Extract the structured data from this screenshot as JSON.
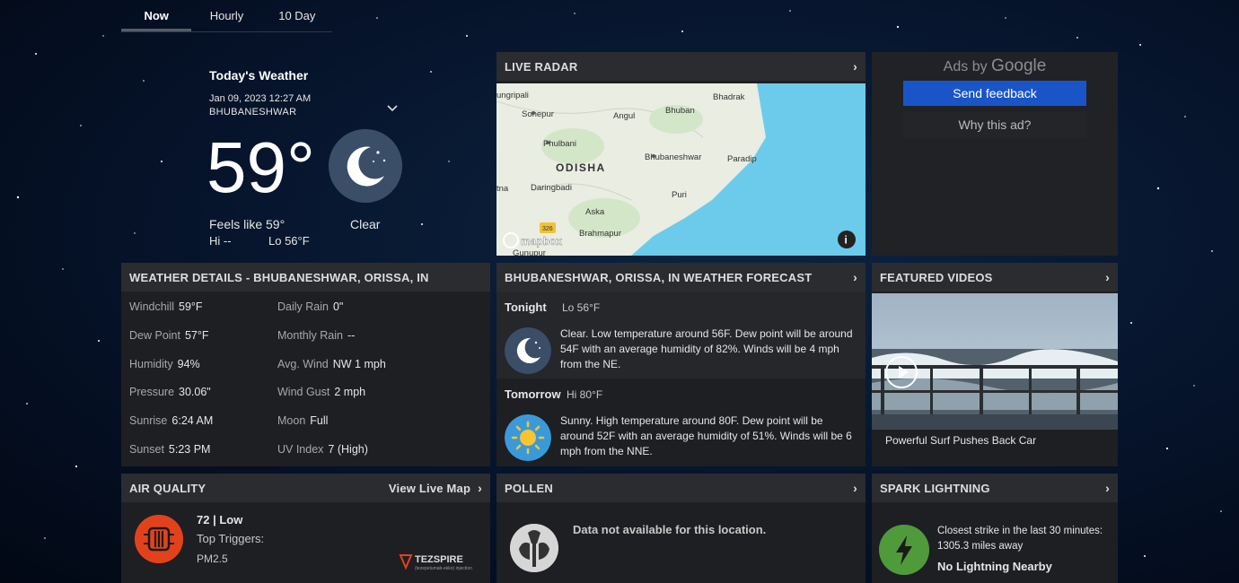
{
  "tabs": [
    {
      "label": "Now"
    },
    {
      "label": "Hourly"
    },
    {
      "label": "10 Day"
    }
  ],
  "today": {
    "title": "Today's Weather",
    "date": "Jan 09, 2023 12:27 AM",
    "city": "BHUBANESHWAR",
    "temp": "59°",
    "feels": "Feels like 59°",
    "condition": "Clear",
    "hi": "Hi --",
    "lo": "Lo 56°F",
    "icon": "moon-icon"
  },
  "radar": {
    "title": "LIVE RADAR",
    "state_label": "ODISHA",
    "places": [
      "ungripali",
      "Sonepur",
      "Angul",
      "Bhuban",
      "Bhadrak",
      "Phulbani",
      "Bhubaneshwar",
      "Paradip",
      "tna",
      "Daringbadi",
      "Puri",
      "Aska",
      "Brahmapur",
      "Gunupur"
    ],
    "road_badge": "326",
    "attribution": "mapbox"
  },
  "ads": {
    "ads_by": "Ads by",
    "google": "Google",
    "feedback": "Send feedback",
    "why": "Why this ad?"
  },
  "details": {
    "title": "WEATHER DETAILS - BHUBANESHWAR, ORISSA, IN",
    "rows": [
      {
        "l1": "Windchill",
        "v1": "59°F",
        "l2": "Daily Rain",
        "v2": "0\""
      },
      {
        "l1": "Dew Point",
        "v1": "57°F",
        "l2": "Monthly Rain",
        "v2": "--"
      },
      {
        "l1": "Humidity",
        "v1": "94%",
        "l2": "Avg. Wind",
        "v2": "NW 1 mph"
      },
      {
        "l1": "Pressure",
        "v1": "30.06\"",
        "l2": "Wind Gust",
        "v2": "2 mph"
      },
      {
        "l1": "Sunrise",
        "v1": "6:24 AM",
        "l2": "Moon",
        "v2": "Full"
      },
      {
        "l1": "Sunset",
        "v1": "5:23 PM",
        "l2": "UV Index",
        "v2": "7 (High)"
      }
    ]
  },
  "forecast": {
    "title": "BHUBANESHWAR, ORISSA, IN WEATHER FORECAST",
    "tonight_label": "Tonight",
    "tonight_temp": "Lo 56°F",
    "tonight_text": "Clear. Low temperature around 56F. Dew point will be around 54F with an average humidity of 82%. Winds will be 4 mph from the NE.",
    "tomorrow_label": "Tomorrow",
    "tomorrow_temp": "Hi 80°F",
    "tomorrow_text": "Sunny. High temperature around 80F. Dew point will be around 52F with an average humidity of 51%. Winds will be 6 mph from the NNE."
  },
  "videos": {
    "title": "FEATURED VIDEOS",
    "caption": "Powerful Surf Pushes Back Car"
  },
  "air_quality": {
    "title": "AIR QUALITY",
    "live_map": "View Live Map",
    "value": "72 | Low",
    "triggers": "Top Triggers:",
    "pm": "PM2.5",
    "brand": "TEZSPIRE",
    "brand_sub": "(tezepelumab-ekko) injection"
  },
  "pollen": {
    "title": "POLLEN",
    "message": "Data not available for this location."
  },
  "lightning": {
    "title": "SPARK LIGHTNING",
    "line1": "Closest strike in the last 30 minutes:",
    "line2": "1305.3 miles away",
    "line3": "No Lightning Nearby"
  }
}
